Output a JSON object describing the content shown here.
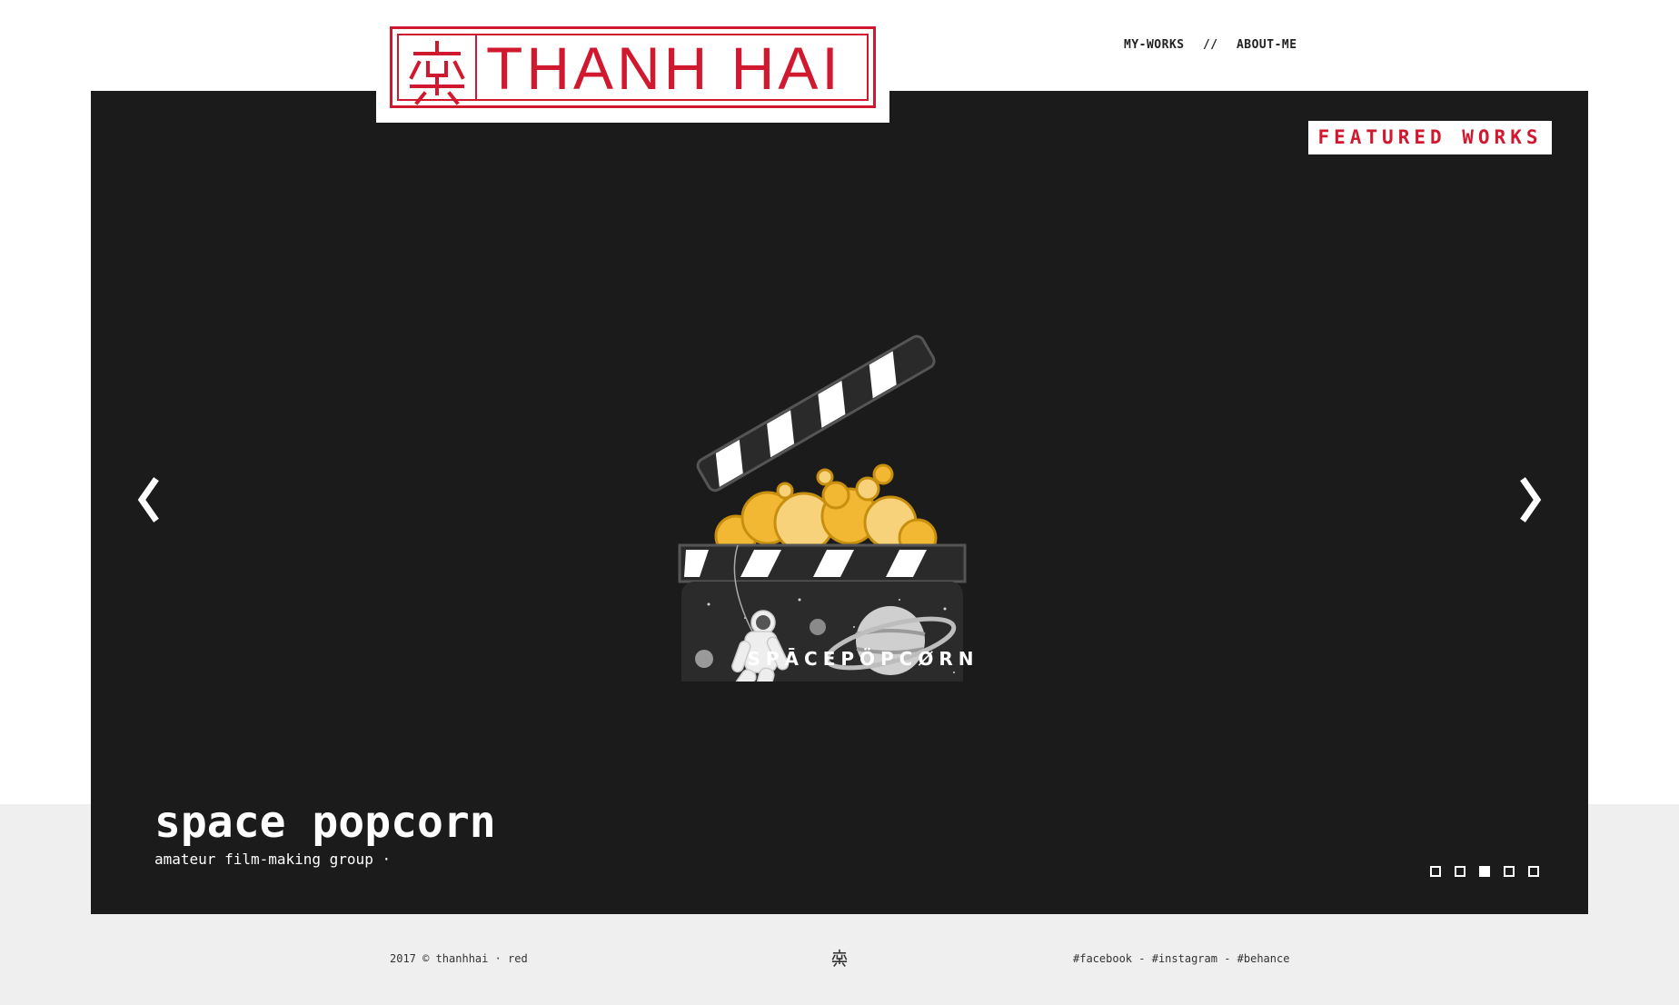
{
  "brand": {
    "logo_text": "THANH HAI",
    "logo_glyph_icon": "thanh-hai-seal-glyph",
    "color": "#d0182f"
  },
  "nav": {
    "items": [
      "MY-WORKS",
      "ABOUT-ME"
    ],
    "separator": "//"
  },
  "slider": {
    "badge": "FEATURED WORKS",
    "prev_icon": "chevron-left-icon",
    "next_icon": "chevron-right-icon",
    "current": {
      "title": "space popcorn",
      "subtitle": "amateur film-making group ·",
      "artwork_wordmark": "SPĀCEPÖPCØRN"
    },
    "slide_count": 5,
    "active_index": 2,
    "background": "#1b1b1b"
  },
  "footer": {
    "copyright": "2017 © thanhhai · red",
    "center_icon": "thanh-hai-mark-icon",
    "links": [
      "#facebook",
      "#instagram",
      "#behance"
    ],
    "link_separator": " - "
  }
}
